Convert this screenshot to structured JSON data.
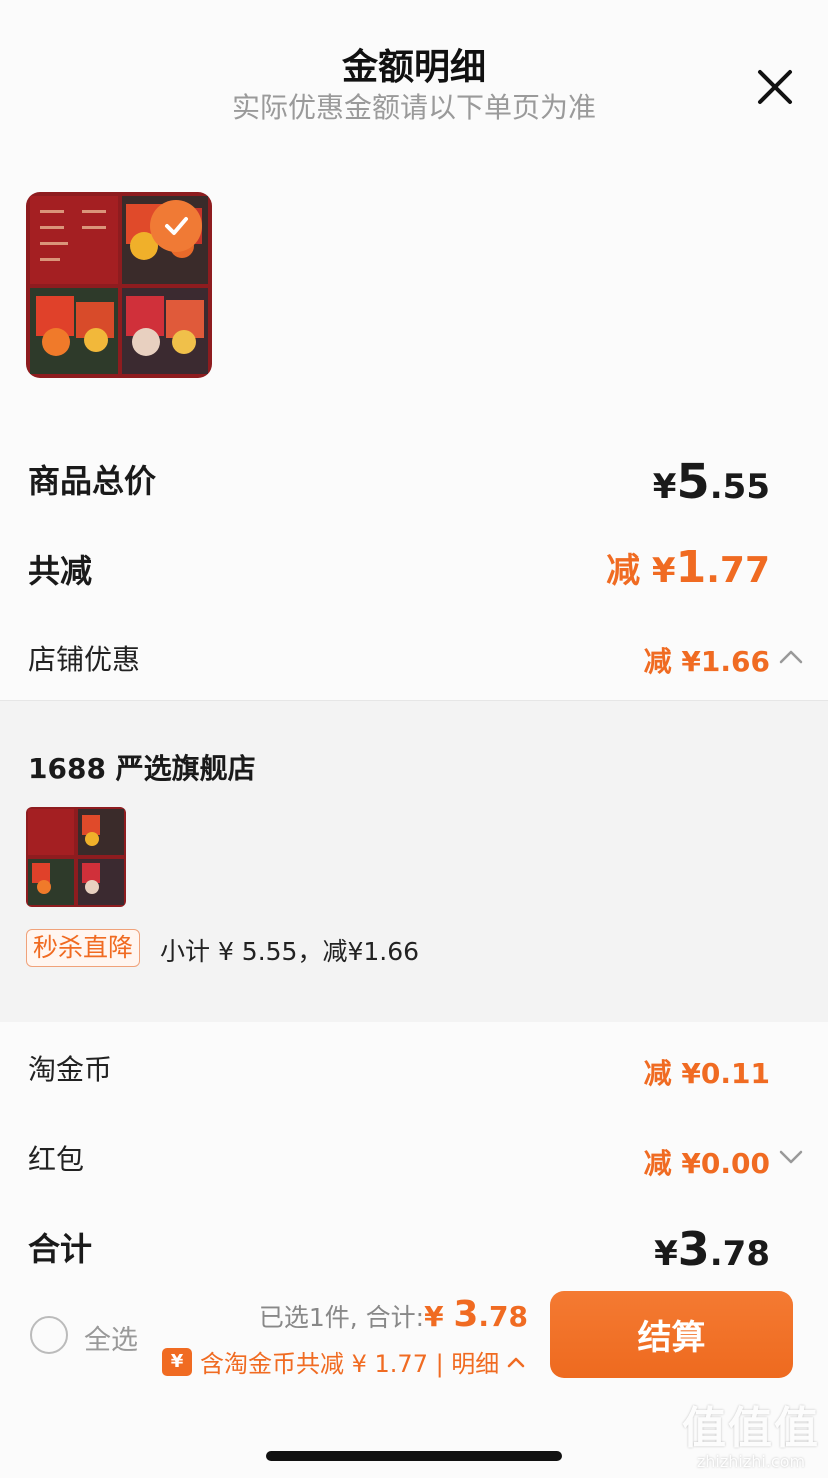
{
  "header": {
    "title": "金额明细",
    "subtitle": "实际优惠金额请以下单页为准"
  },
  "summary": {
    "total_label": "商品总价",
    "total_symbol": "¥",
    "total_int": "5",
    "total_dec": ".55",
    "reduce_label": "共减",
    "reduce_prefix": "减 ¥",
    "reduce_int": "1",
    "reduce_dec": ".77",
    "shop_discount_label": "店铺优惠",
    "shop_discount_value": "减 ¥1.66"
  },
  "shop": {
    "name": "1688 严选旗舰店",
    "promo_tag": "秒杀直降",
    "subtotal_text": "小计 ¥ 5.55，减¥1.66"
  },
  "coins": {
    "label": "淘金币",
    "value": "减 ¥0.11"
  },
  "red_packet": {
    "label": "红包",
    "value": "减 ¥0.00"
  },
  "grand_total": {
    "label": "合计",
    "symbol": "¥",
    "int": "3",
    "dec": ".78"
  },
  "footer": {
    "select_all": "全选",
    "selected_prefix": "已选1件, 合计:",
    "selected_amount_symbol": "¥ ",
    "selected_amount_int": "3",
    "selected_amount_dec": ".78",
    "coin_icon": "¥",
    "coin_text": "含淘金币共减 ¥ 1.77 | 明细",
    "checkout": "结算"
  },
  "watermark": {
    "big": "值值值",
    "small": "zhizhizhi.com"
  },
  "colors": {
    "accent": "#f06b22",
    "panel": "#f3f3f3"
  }
}
